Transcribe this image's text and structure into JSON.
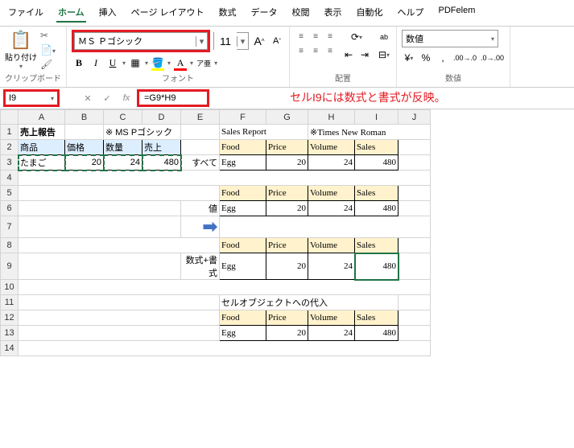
{
  "menu": {
    "file": "ファイル",
    "home": "ホーム",
    "insert": "挿入",
    "pagelayout": "ページ レイアウト",
    "formulas": "数式",
    "data": "データ",
    "review": "校閲",
    "view": "表示",
    "auto": "自動化",
    "help": "ヘルプ",
    "pdf": "PDFelem"
  },
  "ribbon": {
    "clipboard": {
      "label": "クリップボード",
      "paste": "貼り付け"
    },
    "font": {
      "label": "フォント",
      "name": "ＭＳ Ｐゴシック",
      "size": "11",
      "b": "B",
      "i": "I",
      "u": "U",
      "a_up": "A",
      "a_dn": "A",
      "ruby": "ア亜"
    },
    "align": {
      "label": "配置",
      "wrap_icon": "ab"
    },
    "number": {
      "label": "数値",
      "format": "数値"
    }
  },
  "formulabar": {
    "cell": "I9",
    "formula": "=G9*H9",
    "fx": "fx"
  },
  "annotation": "セルI9には数式と書式が反映。",
  "cols": [
    "A",
    "B",
    "C",
    "D",
    "E",
    "F",
    "G",
    "H",
    "I",
    "J"
  ],
  "rows": [
    "1",
    "2",
    "3",
    "4",
    "5",
    "6",
    "7",
    "8",
    "9",
    "10",
    "11",
    "12",
    "13",
    "14"
  ],
  "jp": {
    "title": "売上報告",
    "note": "※ MS Pゴシック",
    "h1": "商品",
    "h2": "価格",
    "h3": "数量",
    "h4": "売上",
    "c1": "たまご",
    "c2": "20",
    "c3": "24",
    "c4": "480"
  },
  "en": {
    "title": "Sales Report",
    "note": "※Times New Roman",
    "h1": "Food",
    "h2": "Price",
    "h3": "Volume",
    "h4": "Sales",
    "c1": "Egg",
    "c2": "20",
    "c3": "24",
    "c4": "480"
  },
  "labels": {
    "all": "すべて",
    "value": "値",
    "formula_format": "数式+書式",
    "assign": "セルオブジェクトへの代入"
  }
}
